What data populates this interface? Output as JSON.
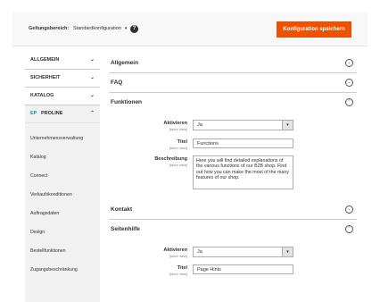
{
  "scope": {
    "label": "Geltungsbereich:",
    "selected": "Standardkonfiguration",
    "help_glyph": "?"
  },
  "toolbar": {
    "save_label": "Konfiguration speichern"
  },
  "sidebar": {
    "tabs": [
      {
        "label": "ALLGEMEIN"
      },
      {
        "label": "SICHERHEIT"
      },
      {
        "label": "KATALOG"
      }
    ],
    "group": {
      "logo": "EP",
      "label": "PROLINE"
    },
    "items": [
      {
        "label": "Unternehmensverwaltung"
      },
      {
        "label": "Katalog"
      },
      {
        "label": "Connect"
      },
      {
        "label": "Verkaufskonditionen"
      },
      {
        "label": "Auftragsdaten"
      },
      {
        "label": "Design"
      },
      {
        "label": "Bestellfunktionen"
      },
      {
        "label": "Zugangsbeschränkung"
      }
    ]
  },
  "sections": {
    "allgemein": {
      "title": "Allgemein"
    },
    "faq": {
      "title": "FAQ"
    },
    "funktionen": {
      "title": "Funktionen",
      "fields": {
        "aktivieren": {
          "label": "Aktivieren",
          "scope": "[store view]",
          "value": "Ja"
        },
        "titel": {
          "label": "Titel",
          "scope": "[store view]",
          "value": "Functions"
        },
        "beschreibung": {
          "label": "Beschreibung",
          "scope": "[store view]",
          "value": "Here you will find detailed explanations of the various functions of our B2B shop. Find out how you can make the most of the many features of our shop."
        }
      }
    },
    "kontakt": {
      "title": "Kontakt"
    },
    "seitenhilfe": {
      "title": "Seitenhilfe",
      "fields": {
        "aktivieren": {
          "label": "Aktivieren",
          "scope": "[store view]",
          "value": "Ja"
        },
        "titel": {
          "label": "Titel",
          "scope": "[store view]",
          "value": "Page Hints"
        }
      }
    }
  },
  "icons": {
    "collapse": "⊖",
    "expand": "⊖",
    "chevron_down": "⌄",
    "chevron_up": "⌃",
    "select_arrow": "▾"
  },
  "colors": {
    "accent": "#eb5202",
    "logo": "#2d8c9e"
  }
}
